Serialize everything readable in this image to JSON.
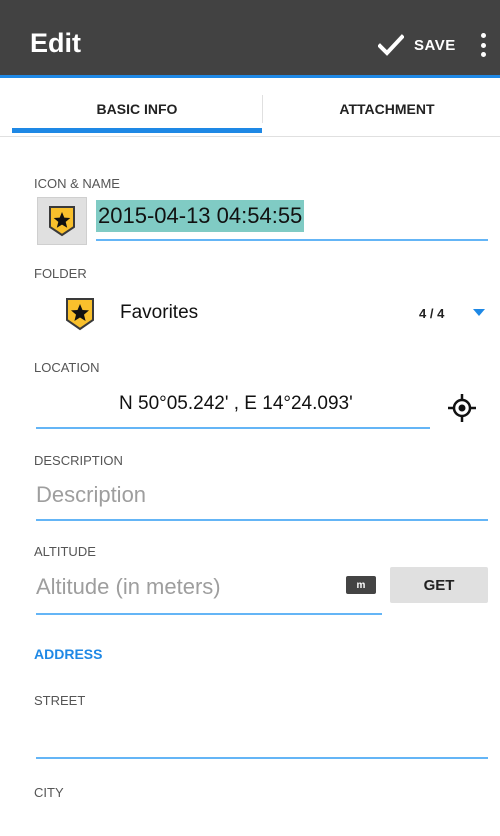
{
  "toolbar": {
    "title": "Edit",
    "save_label": "SAVE",
    "save_icon": "check-icon",
    "overflow_icon": "more-vert-icon"
  },
  "tabs": [
    {
      "label": "BASIC INFO",
      "selected": true
    },
    {
      "label": "ATTACHMENT",
      "selected": false
    }
  ],
  "icon_name": {
    "label": "ICON & NAME",
    "icon": "star-pin-icon",
    "name_value": "2015-04-13 04:54:55"
  },
  "folder": {
    "label": "FOLDER",
    "icon": "star-pin-icon",
    "name": "Favorites",
    "count": "4 / 4"
  },
  "location": {
    "label": "LOCATION",
    "value": "N 50°05.242' , E 14°24.093'",
    "locate_icon": "crosshair-icon"
  },
  "description": {
    "label": "DESCRIPTION",
    "placeholder": "Description"
  },
  "altitude": {
    "label": "ALTITUDE",
    "placeholder": "Altitude (in meters)",
    "unit": "m",
    "get_label": "GET"
  },
  "address": {
    "section_label": "ADDRESS",
    "street_label": "STREET",
    "city_label": "CITY"
  },
  "colors": {
    "accent": "#1e88e5",
    "toolbar_bg": "#424242",
    "selection_highlight": "#80cbc4",
    "pin_yellow": "#f9c02c"
  }
}
